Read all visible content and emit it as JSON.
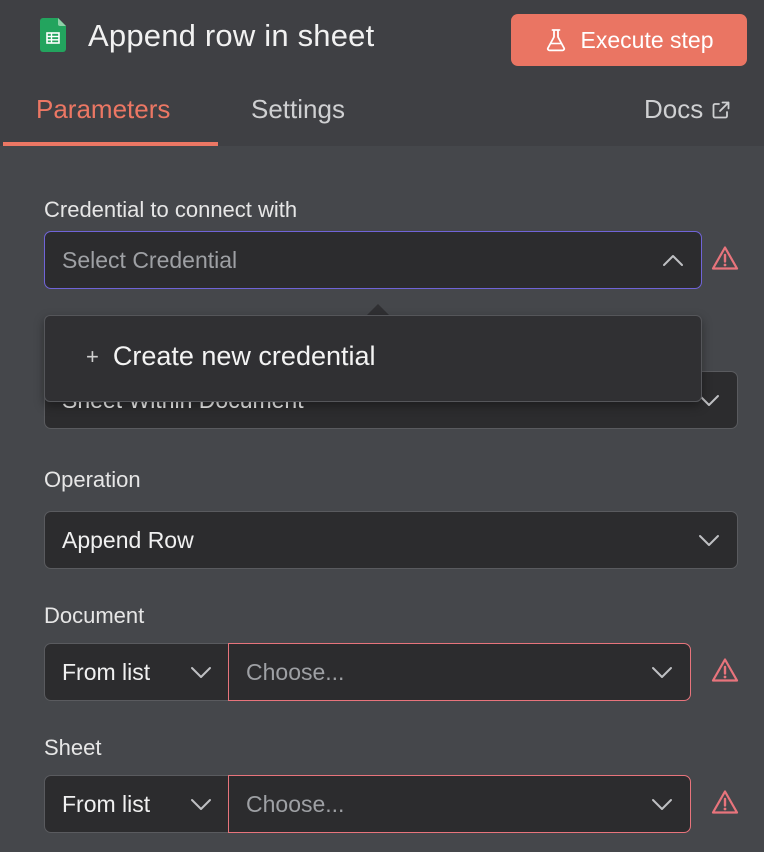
{
  "header": {
    "icon": "google-sheets-icon",
    "title": "Append row in sheet",
    "execute_label": "Execute step",
    "accent_color": "#ea7563"
  },
  "tabs": [
    {
      "label": "Parameters",
      "active": true
    },
    {
      "label": "Settings",
      "active": false
    },
    {
      "label": "Docs",
      "active": false
    }
  ],
  "credential": {
    "label": "Credential to connect with",
    "placeholder": "Select Credential",
    "dropdown_item": "Create new credential"
  },
  "resource": {
    "value": "Sheet Within Document"
  },
  "operation": {
    "label": "Operation",
    "value": "Append Row"
  },
  "document": {
    "label": "Document",
    "mode": "From list",
    "placeholder": "Choose..."
  },
  "sheet": {
    "label": "Sheet",
    "mode": "From list",
    "placeholder": "Choose..."
  }
}
